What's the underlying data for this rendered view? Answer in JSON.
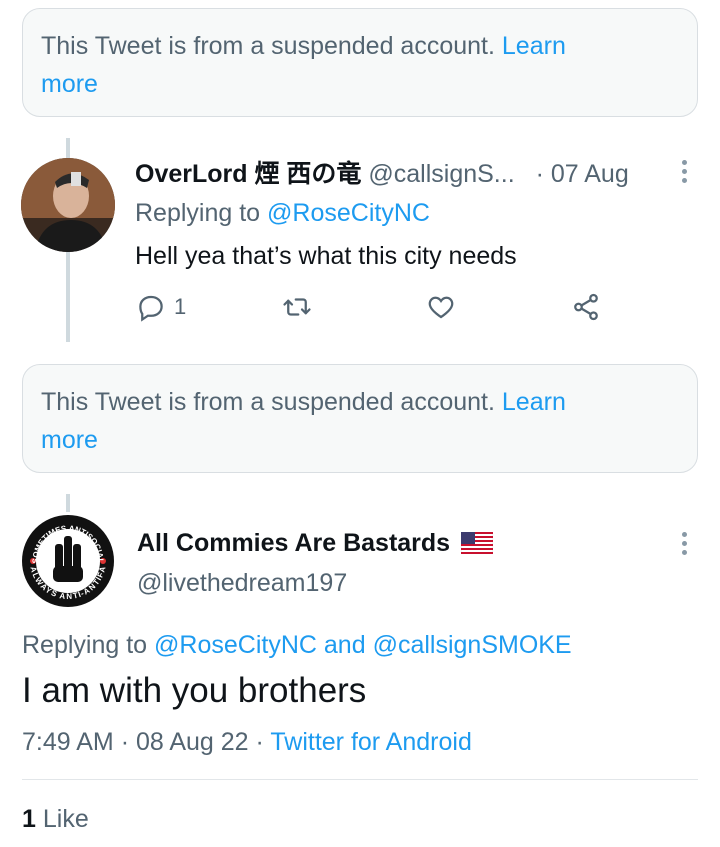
{
  "suspended_notice": {
    "text": "This Tweet is from a suspended account.",
    "link_first": "Learn",
    "link_second": "more"
  },
  "reply_tweet": {
    "display_name": "OverLord 煙 西の竜",
    "handle": "@callsignS...",
    "separator": "·",
    "date": "07 Aug",
    "replying_prefix": "Replying to",
    "replying_to": "@RoseCityNC",
    "text": "Hell yea that’s what this city needs",
    "reply_count": "1",
    "icons": {
      "reply": "reply-icon",
      "retweet": "retweet-icon",
      "like": "heart-icon",
      "share": "share-icon",
      "more": "more-vertical-icon"
    }
  },
  "main_tweet": {
    "display_name": "All Commies Are Bastards",
    "flag": "🇺🇸",
    "handle": "@livethedream197",
    "replying_prefix": "Replying to",
    "replying_to_1": "@RoseCityNC",
    "replying_and": "and",
    "replying_to_2": "@callsignSMOKE",
    "text": "I am with you brothers",
    "time": "7:49 AM",
    "dot": "·",
    "date": "08 Aug 22",
    "source": "Twitter for Android",
    "avatar_logo_text_top": "SOMETIMES ANTISOCIAL",
    "avatar_logo_text_bottom": "ALWAYS ANTI-ANTIFA"
  },
  "engagement": {
    "like_count": "1",
    "like_label": "Like"
  },
  "colors": {
    "link": "#1d9bf0",
    "muted": "#536471",
    "text": "#0f1419",
    "card_bg": "#f7f9f9"
  }
}
